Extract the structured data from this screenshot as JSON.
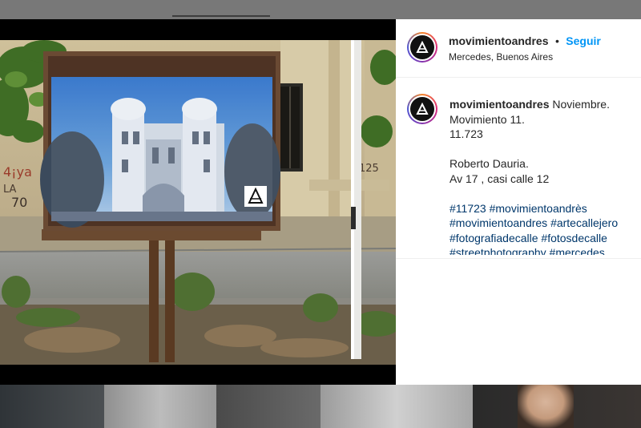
{
  "post": {
    "username": "movimientoandres",
    "separator": "•",
    "follow_label": "Seguir",
    "location": "Mercedes, Buenos Aires",
    "caption": {
      "username": "movimientoandres",
      "line1": "Noviembre.",
      "line2": "Movimiento 11.",
      "line3": "11.723",
      "line4": "Roberto Dauria.",
      "line5": "Av 17 , casi calle 12",
      "hashtags": [
        "#11723",
        "#movimientoandrès",
        "#movimientoandres",
        "#artecallejero",
        "#fotografiadecalle",
        "#fotosdecalle",
        "#streetphotography",
        "#mercedes"
      ]
    }
  },
  "photo": {
    "wall_graffiti": [
      "4¡ya",
      "LA",
      "70",
      "125"
    ]
  },
  "icons": {
    "avatar": "logo-a-icon",
    "board_logo": "logo-a-icon"
  },
  "colors": {
    "follow": "#0095f6",
    "hashtag": "#00376b",
    "text": "#262626"
  }
}
